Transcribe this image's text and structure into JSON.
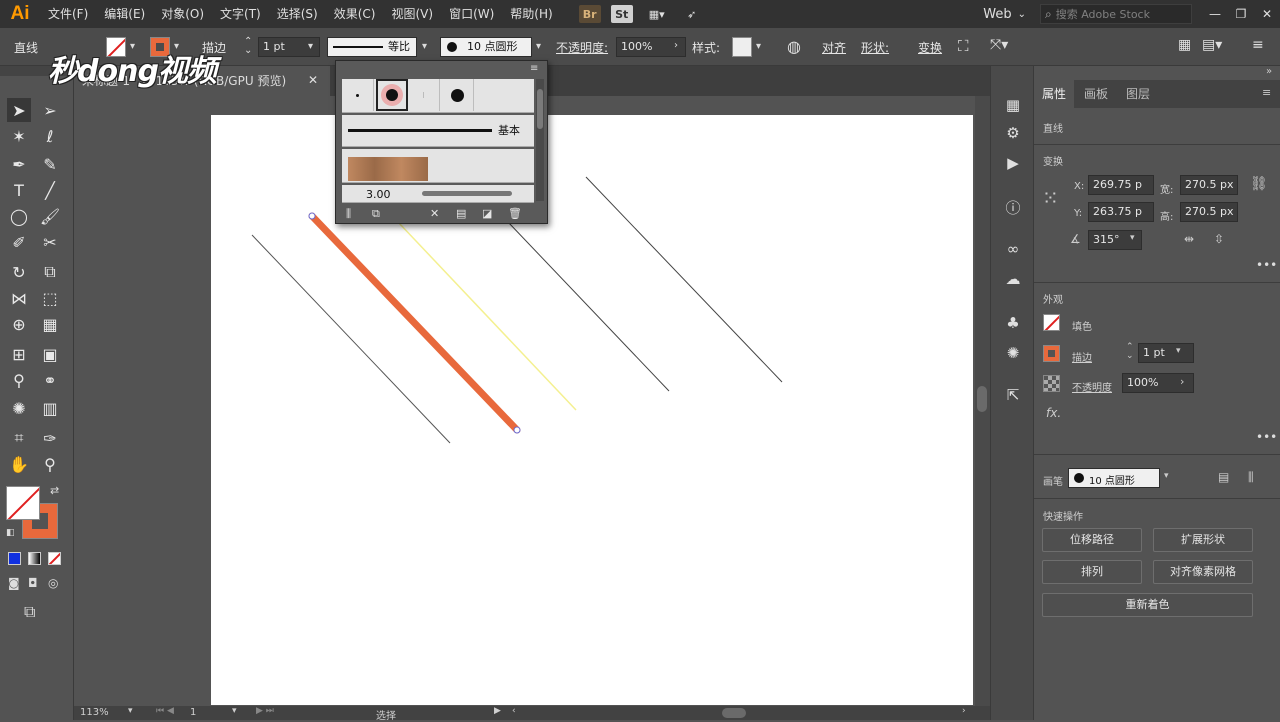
{
  "app": {
    "logo": "Ai",
    "menu": [
      "文件(F)",
      "编辑(E)",
      "对象(O)",
      "文字(T)",
      "选择(S)",
      "效果(C)",
      "视图(V)",
      "窗口(W)",
      "帮助(H)"
    ],
    "bridge_icon": "Br",
    "stock_icon": "St",
    "workspace": "Web",
    "search_placeholder": "搜索 Adobe Stock"
  },
  "control": {
    "object_type": "直线",
    "stroke_label": "描边",
    "stroke_weight": "1 pt",
    "profile_label": "等比",
    "brush_label": "10 点圆形",
    "opacity_label": "不透明度:",
    "opacity_value": "100%",
    "style_label": "样式:",
    "align_label": "对齐",
    "shape_label": "形状:",
    "transform_label": "变换"
  },
  "document": {
    "tab_title": "未标题-1* @ 113% (RGB/GPU 预览)",
    "zoom": "113%",
    "artboard_num": "1",
    "status_text": "选择"
  },
  "brush_popup": {
    "basic_label": "基本",
    "size_label": "3.00"
  },
  "properties": {
    "tabs": [
      "属性",
      "画板",
      "图层"
    ],
    "object_type": "直线",
    "transform_title": "变换",
    "x_label": "X:",
    "x_value": "269.75 p",
    "y_label": "Y:",
    "y_value": "263.75 p",
    "w_label": "宽:",
    "w_value": "270.5 px",
    "h_label": "高:",
    "h_value": "270.5 px",
    "angle_value": "315°",
    "appearance_title": "外观",
    "fill_label": "填色",
    "stroke_label": "描边",
    "stroke_value": "1 pt",
    "opacity_label": "不透明度",
    "opacity_value": "100%",
    "fx_label": "fx.",
    "brush_title": "画笔",
    "brush_value": "10 点圆形",
    "quick_title": "快速操作",
    "btn_offset": "位移路径",
    "btn_expand": "扩展形状",
    "btn_arrange": "排列",
    "btn_align_pixel": "对齐像素网格",
    "btn_recolor": "重新着色"
  },
  "watermark": "秒dong视频",
  "colors": {
    "stroke_orange": "#e8693c",
    "accent_ui": "#ff9a00"
  }
}
